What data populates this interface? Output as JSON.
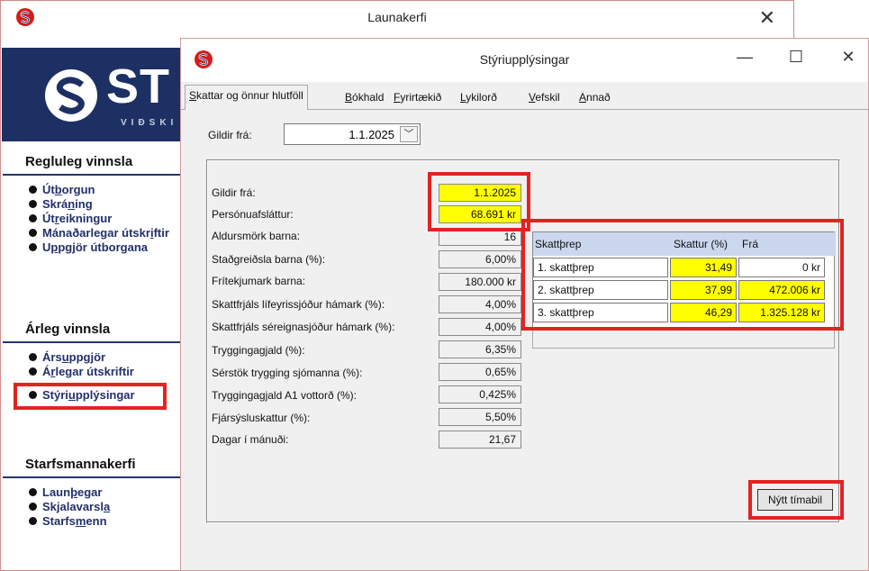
{
  "back_window": {
    "title": "Launakerfi",
    "close": "✕",
    "banner": {
      "logo_text": "ST",
      "logo_sub": "VIÐSKI"
    }
  },
  "sidebar": {
    "sections": [
      {
        "title": "Regluleg vinnsla",
        "items": [
          {
            "pre": "Út",
            "ul": "b",
            "post": "orgun"
          },
          {
            "pre": "Skrá",
            "ul": "n",
            "post": "ing"
          },
          {
            "pre": "Út",
            "ul": "r",
            "post": "eikningur"
          },
          {
            "pre": "Mánaðarlegar útskr",
            "ul": "i",
            "post": "ftir"
          },
          {
            "pre": "U",
            "ul": "p",
            "post": "pgjör útborgana"
          }
        ]
      },
      {
        "title": "Árleg vinnsla",
        "items": [
          {
            "pre": "Árs",
            "ul": "u",
            "post": "ppgjör"
          },
          {
            "pre": "Á",
            "ul": "r",
            "post": "legar útskriftir"
          },
          {
            "pre": "Stýri",
            "ul": "u",
            "post": "pplýsingar"
          }
        ]
      },
      {
        "title": "Starfsmannakerfi",
        "items": [
          {
            "pre": "Laun",
            "ul": "þ",
            "post": "egar"
          },
          {
            "pre": "Skjalavarsl",
            "ul": "a",
            "post": ""
          },
          {
            "pre": "Starfs",
            "ul": "m",
            "post": "enn"
          }
        ]
      }
    ]
  },
  "dialog": {
    "title": "Stýriupplýsingar",
    "controls": {
      "minimize": "—",
      "maximize": "☐",
      "close": "✕"
    },
    "tabs": [
      {
        "pre": "",
        "ul": "S",
        "post": "kattar og önnur hlutföll"
      },
      {
        "pre": "",
        "ul": "B",
        "post": "ókhald"
      },
      {
        "pre": "",
        "ul": "F",
        "post": "yrirtækið"
      },
      {
        "pre": "",
        "ul": "L",
        "post": "ykilorð"
      },
      {
        "pre": "",
        "ul": "V",
        "post": "efskil"
      },
      {
        "pre": "",
        "ul": "A",
        "post": "nnað"
      }
    ],
    "top_label": "Gildir frá:",
    "top_value": "1.1.2025",
    "combo_arrow": "﹀",
    "fields": [
      {
        "label": "Gildir frá:",
        "value": "1.1.2025"
      },
      {
        "label": "Persónuafsláttur:",
        "value": "68.691 kr"
      },
      {
        "label": "Aldursmörk barna:",
        "value": "16"
      },
      {
        "label": "Staðgreiðsla barna (%):",
        "value": "6,00%"
      },
      {
        "label": "Frítekjumark barna:",
        "value": "180.000 kr"
      },
      {
        "label": "Skattfrjáls lífeyrissjóður hámark (%):",
        "value": "4,00%"
      },
      {
        "label": "Skattfrjáls séreignasjóður hámark (%):",
        "value": "4,00%"
      },
      {
        "label": "Tryggingagjald (%):",
        "value": "6,35%"
      },
      {
        "label": "Sérstök trygging sjómanna (%):",
        "value": "0,65%"
      },
      {
        "label": "Tryggingagjald A1 vottorð (%):",
        "value": "0,425%"
      },
      {
        "label": "Fjársýsluskattur (%):",
        "value": "5,50%"
      },
      {
        "label": "Dagar í mánuði:",
        "value": "21,67"
      }
    ],
    "tax_table": {
      "headers": [
        "Skattþrep",
        "Skattur (%)",
        "Frá"
      ],
      "rows": [
        {
          "name": "1. skattþrep",
          "rate": "31,49",
          "from": "0 kr"
        },
        {
          "name": "2. skattþrep",
          "rate": "37,99",
          "from": "472.006 kr"
        },
        {
          "name": "3. skattþrep",
          "rate": "46,29",
          "from": "1.325.128 kr"
        }
      ]
    },
    "new_period_button": "Nýtt tímabil"
  },
  "colors": {
    "highlight": "#ffff00",
    "annotation": "#e32222",
    "header": "#cad7ee",
    "brand": "#1d3063"
  },
  "icons": {
    "app_logo": "s-logo-icon"
  }
}
